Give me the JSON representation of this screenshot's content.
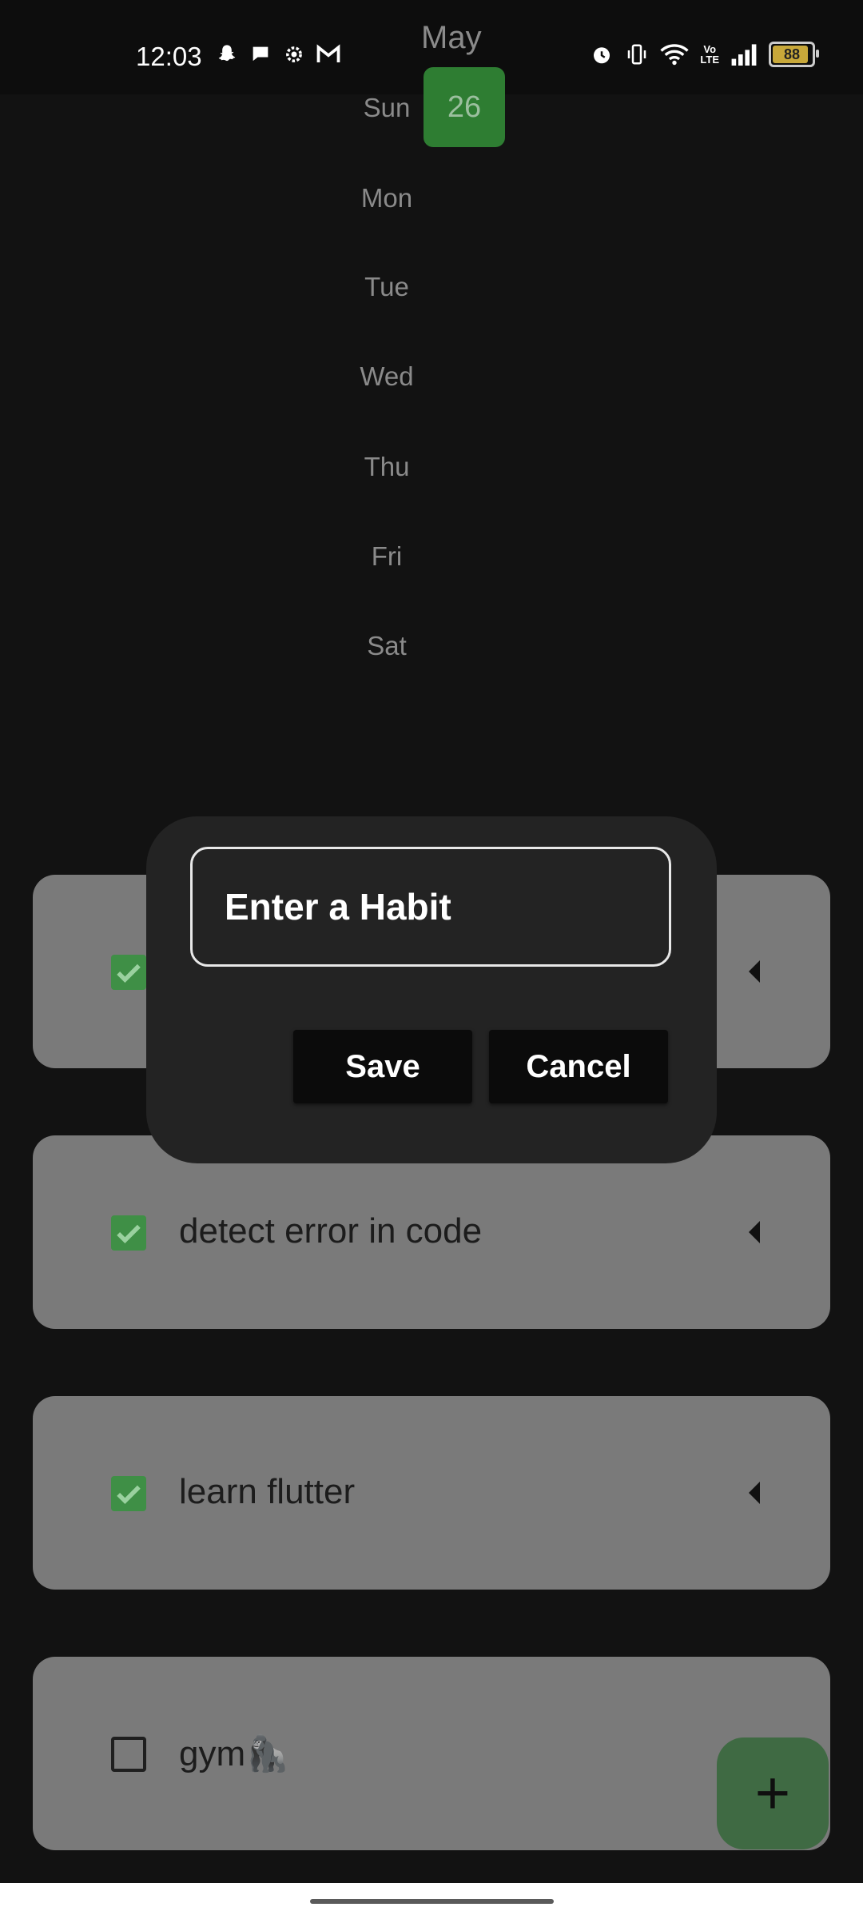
{
  "status_bar": {
    "time": "12:03",
    "left_icons": [
      "snapchat-icon",
      "chat-icon",
      "settings-icon",
      "gmail-icon"
    ],
    "right_icons": [
      "alarm-icon",
      "vibrate-icon",
      "wifi-icon",
      "volte-icon",
      "signal-icon"
    ],
    "volte_label": "Vo\nLTE",
    "battery_level": "88"
  },
  "calendar": {
    "month": "May",
    "days": [
      "Sun",
      "Mon",
      "Tue",
      "Wed",
      "Thu",
      "Fri",
      "Sat"
    ],
    "selected_date": "26"
  },
  "habits": [
    {
      "label": "",
      "checked": true
    },
    {
      "label": "detect error in code",
      "checked": true
    },
    {
      "label": "learn flutter",
      "checked": true
    },
    {
      "label": "gym🦍",
      "checked": false
    }
  ],
  "dialog": {
    "input_placeholder": "Enter a Habit",
    "save_label": "Save",
    "cancel_label": "Cancel"
  },
  "fab": {
    "icon": "plus-icon"
  },
  "colors": {
    "background": "#121212",
    "accent_green": "#2e7d32",
    "card": "#7a7a7a",
    "dialog": "#232323"
  }
}
